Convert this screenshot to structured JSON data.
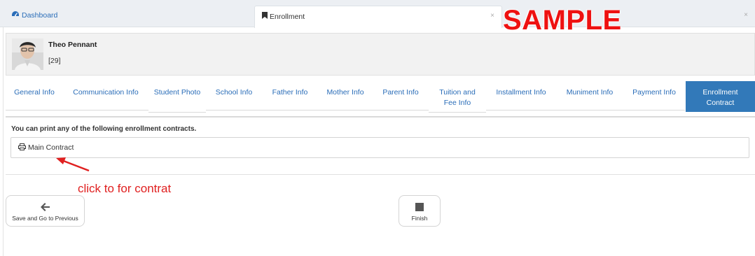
{
  "tabs": {
    "dashboard_label": "Dashboard",
    "enrollment_label": "Enrollment",
    "close_glyph": "×"
  },
  "watermark": "SAMPLE",
  "student": {
    "name": "Theo Pennant",
    "id": "[29]"
  },
  "subtabs": [
    {
      "label": "General Info"
    },
    {
      "label": "Communication Info"
    },
    {
      "label": "Student Photo"
    },
    {
      "label": "School Info"
    },
    {
      "label": "Father Info"
    },
    {
      "label": "Mother Info"
    },
    {
      "label": "Parent Info"
    },
    {
      "label": "Tuition and Fee Info"
    },
    {
      "label": "Installment Info"
    },
    {
      "label": "Muniment Info"
    },
    {
      "label": "Payment Info"
    },
    {
      "label": "Enrollment Contract"
    }
  ],
  "contracts": {
    "note": "You can print any of the following enrollment contracts.",
    "main_contract_label": "Main Contract"
  },
  "annotation": "click to for contrat",
  "buttons": {
    "prev_label": "Save and Go to Previous",
    "finish_label": "Finish"
  },
  "colors": {
    "accent": "#3279b9",
    "link": "#2a6db8",
    "annotation_red": "#e02020",
    "watermark_red": "#ee1111"
  },
  "icons": {
    "dashboard": "tachometer-icon",
    "enrollment": "bookmark-icon",
    "print": "print-icon",
    "prev": "arrow-left-icon",
    "finish": "stop-icon"
  }
}
